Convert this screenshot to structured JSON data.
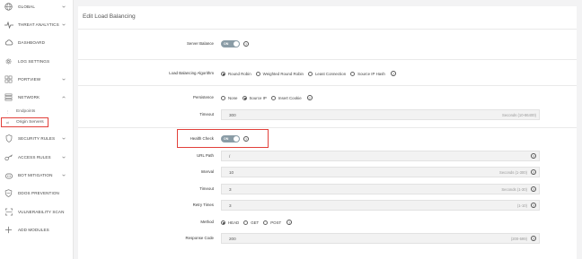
{
  "sidebar": {
    "items": [
      {
        "label": "GLOBAL",
        "icon": "globe-icon",
        "chevron": true
      },
      {
        "label": "THREAT ANALYTICS",
        "icon": "pulse-icon",
        "chevron": true
      },
      {
        "label": "DASHBOARD",
        "icon": "cloud-icon",
        "chevron": false
      },
      {
        "label": "LOG SETTINGS",
        "icon": "gear-icon",
        "chevron": false
      },
      {
        "label": "PORTVIEW",
        "icon": "grid-icon",
        "chevron": true
      },
      {
        "label": "NETWORK",
        "icon": "network-icon",
        "chevron": true
      },
      {
        "label": "SECURITY RULES",
        "icon": "shield-icon",
        "chevron": true
      },
      {
        "label": "ACCESS RULES",
        "icon": "key-icon",
        "chevron": true
      },
      {
        "label": "BOT MITIGATION",
        "icon": "robot-icon",
        "chevron": true
      },
      {
        "label": "DDOS PREVENTION",
        "icon": "ddos-icon",
        "chevron": false
      },
      {
        "label": "VULNERABILITY SCAN",
        "icon": "scan-icon",
        "chevron": false
      },
      {
        "label": "ADD MODULES",
        "icon": "plus-icon",
        "chevron": false
      }
    ],
    "sub_items": [
      {
        "label": "Endpoints",
        "icon": "endpoint-icon"
      },
      {
        "label": "Origin Servers",
        "icon": "server-icon"
      }
    ]
  },
  "main": {
    "title": "Edit Load Balancing",
    "server_balance": {
      "label": "Server Balance",
      "toggle": "ON"
    },
    "algorithm": {
      "label": "Load Balancing Algorithm",
      "options": [
        "Round Robin",
        "Weighted Round Robin",
        "Least Connection",
        "Source IP Hash"
      ],
      "selected": 0
    },
    "persistence": {
      "label": "Persistence",
      "options": [
        "None",
        "Source IP",
        "Insert Cookie"
      ],
      "selected": 1
    },
    "timeout": {
      "label": "Timeout",
      "value": "300",
      "hint": "Seconds (10-86400)"
    },
    "health_check": {
      "label": "Health Check",
      "toggle": "ON"
    },
    "url_path": {
      "label": "URL Path",
      "value": "/"
    },
    "interval": {
      "label": "Interval",
      "value": "10",
      "hint": "Seconds (1-300)"
    },
    "hc_timeout": {
      "label": "Timeout",
      "value": "3",
      "hint": "Seconds (1-30)"
    },
    "retry": {
      "label": "Retry Times",
      "value": "3",
      "hint": "(1-10)"
    },
    "method": {
      "label": "Method",
      "options": [
        "HEAD",
        "GET",
        "POST"
      ],
      "selected": 0
    },
    "response_code": {
      "label": "Response Code",
      "value": "200",
      "hint": "(200-599)"
    }
  },
  "colors": {
    "highlight": "#e2403a",
    "toggle": "#8a9ca6"
  }
}
